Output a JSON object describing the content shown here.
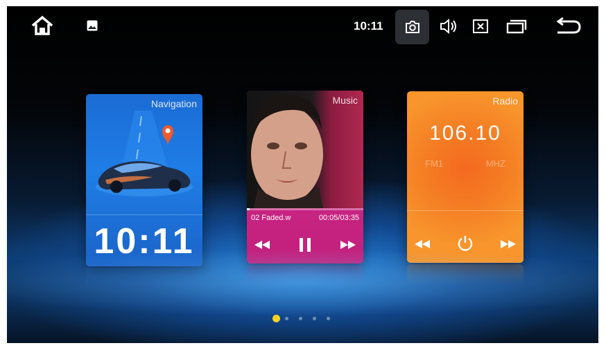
{
  "status_bar": {
    "time": "10:11",
    "icons": [
      "home-icon",
      "gallery-icon",
      "camera-icon",
      "volume-icon",
      "close-app-icon",
      "recent-apps-icon",
      "back-icon"
    ]
  },
  "cards": {
    "navigation": {
      "title": "Navigation",
      "clock": "10:11"
    },
    "music": {
      "title": "Music",
      "track": "02 Faded.w",
      "time": "00:05/03:35",
      "progress_fraction": 0.023,
      "controls": [
        "rewind-icon",
        "pause-icon",
        "fast-forward-icon"
      ]
    },
    "radio": {
      "title": "Radio",
      "frequency": "106.10",
      "band": "FM1",
      "unit": "MHZ",
      "controls": [
        "rewind-icon",
        "power-icon",
        "fast-forward-icon"
      ]
    }
  },
  "pager": {
    "count": 5,
    "active_index": 0
  },
  "colors": {
    "navigation": "#1b6bd4",
    "music": "#c8267f",
    "radio": "#f58a2a",
    "pager_active": "#ffd21e"
  }
}
